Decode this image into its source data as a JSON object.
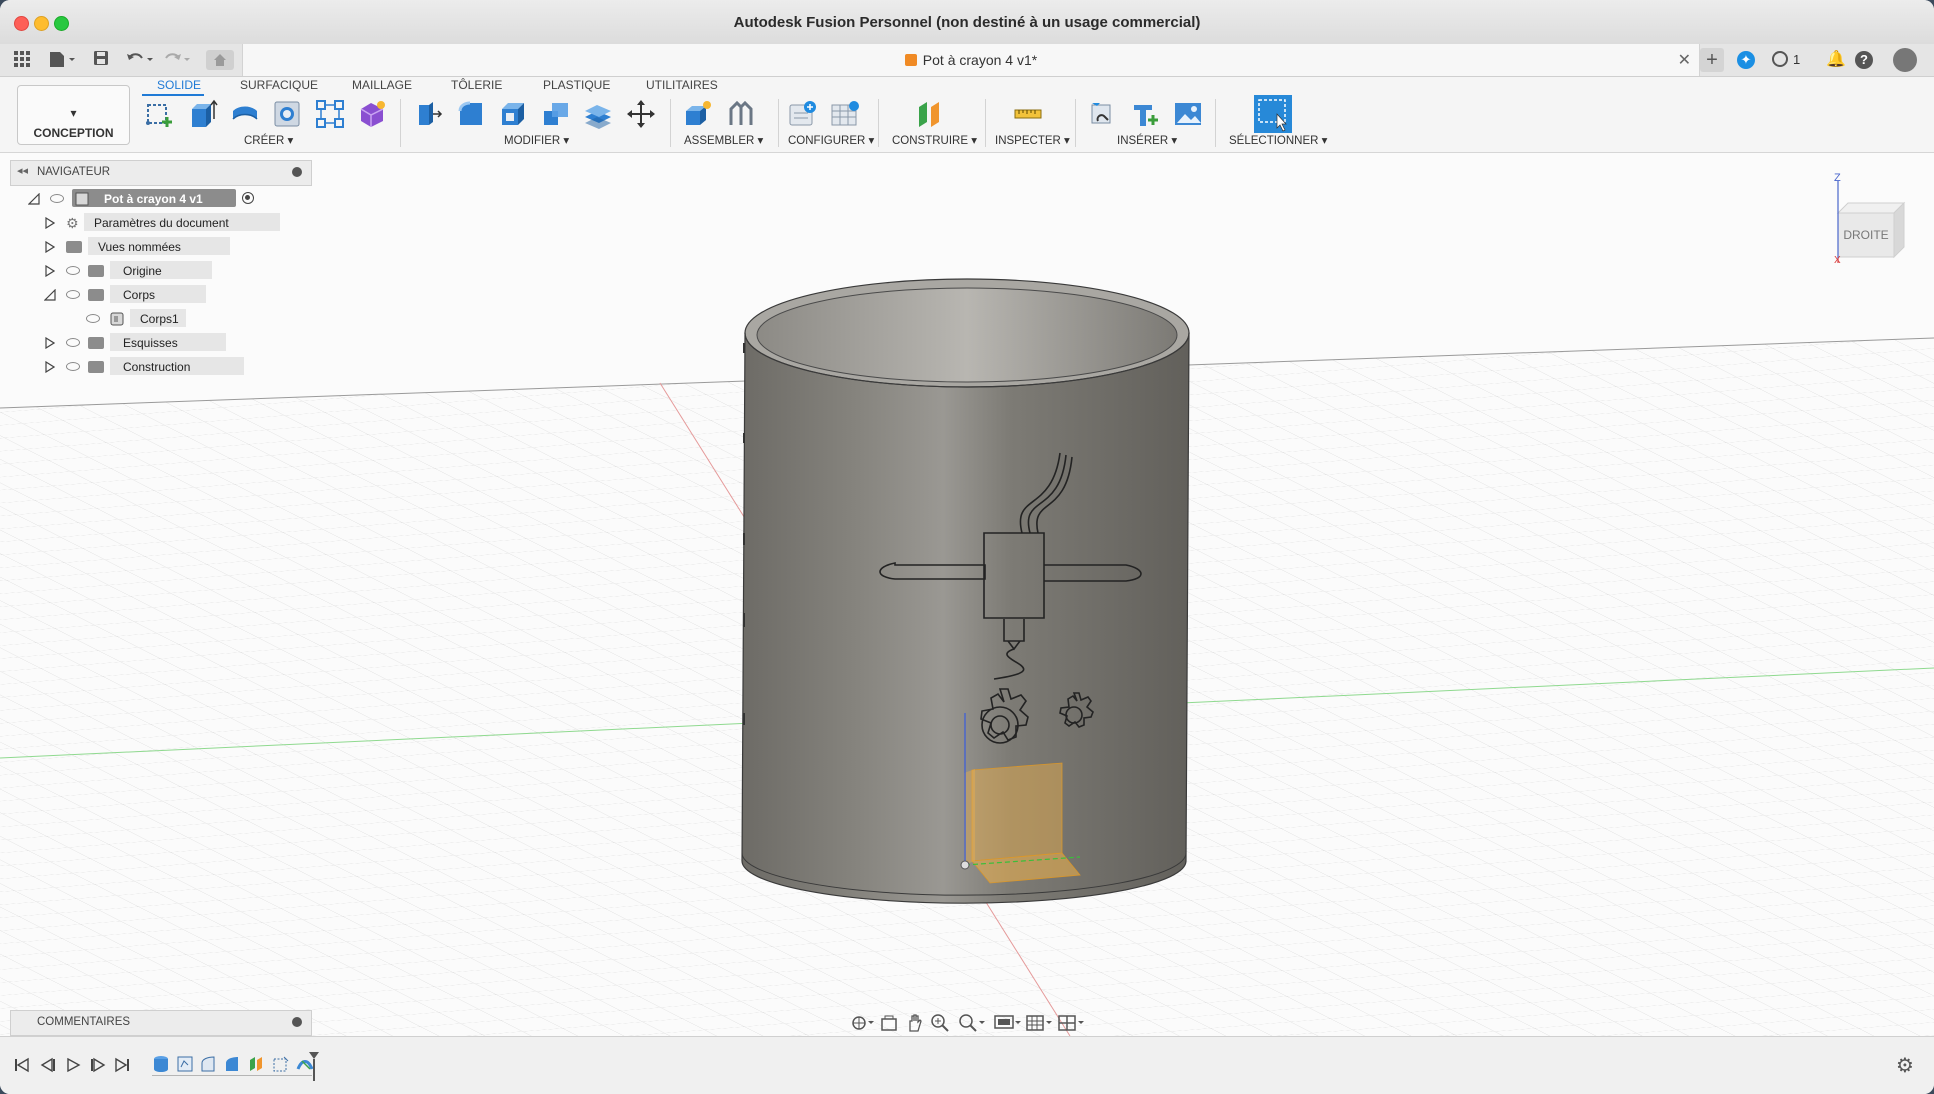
{
  "window": {
    "title": "Autodesk Fusion Personnel (non destiné à un usage commercial)"
  },
  "document_tab": {
    "title": "Pot à crayon 4 v1*"
  },
  "appbar": {
    "job_count": "1"
  },
  "ribbon": {
    "workspace": "CONCEPTION",
    "tabs": [
      "SOLIDE",
      "SURFACIQUE",
      "MAILLAGE",
      "TÔLERIE",
      "PLASTIQUE",
      "UTILITAIRES"
    ],
    "active_tab": "SOLIDE",
    "groups": [
      "CRÉER",
      "MODIFIER",
      "ASSEMBLER",
      "CONFIGURER",
      "CONSTRUIRE",
      "INSPECTER",
      "INSÉRER",
      "SÉLECTIONNER"
    ]
  },
  "navigator": {
    "title": "NAVIGATEUR",
    "root": "Pot à crayon 4 v1",
    "items": [
      {
        "label": "Paramètres du document"
      },
      {
        "label": "Vues nommées"
      },
      {
        "label": "Origine"
      },
      {
        "label": "Corps"
      },
      {
        "label": "Corps1"
      },
      {
        "label": "Esquisses"
      },
      {
        "label": "Construction"
      }
    ]
  },
  "viewcube": {
    "face": "DROITE",
    "axis_z": "Z",
    "axis_x": "X"
  },
  "comments": {
    "title": "COMMENTAIRES"
  },
  "colors": {
    "accent": "#1f7ad6",
    "model": "#7a7771",
    "origin_plane": "#f0b24a"
  }
}
